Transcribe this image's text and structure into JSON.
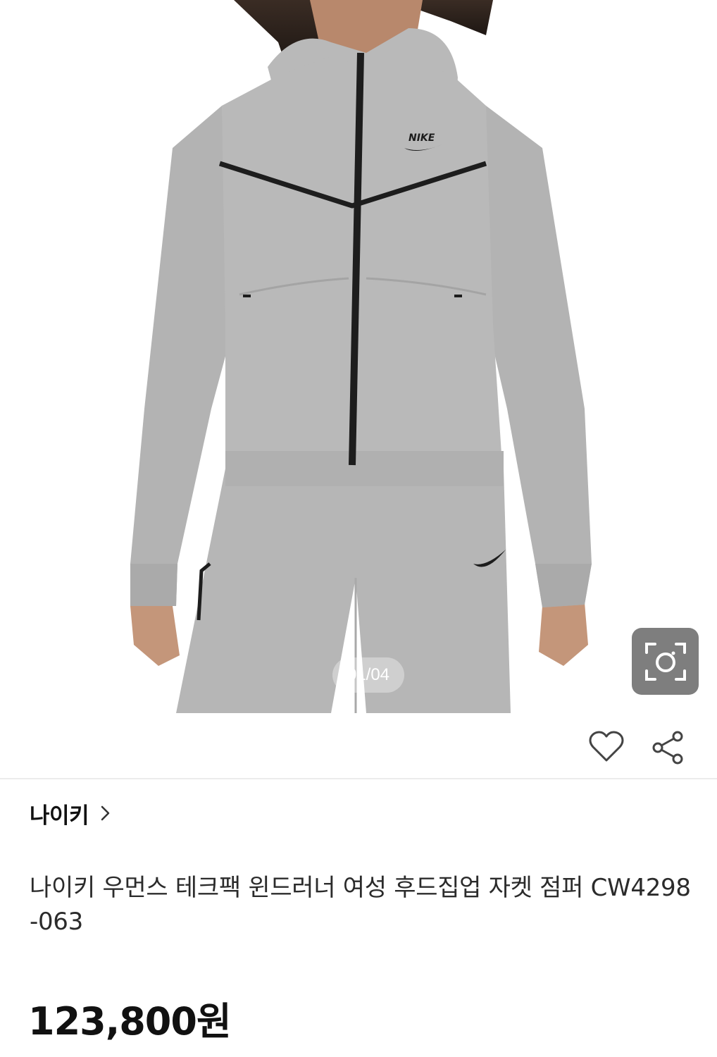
{
  "gallery": {
    "counter": "01/04",
    "garment_logo": "NIKE"
  },
  "icons": {
    "lens": "image-search-icon",
    "like": "heart-outline-icon",
    "share": "share-icon",
    "brand_arrow": "chevron-right-icon"
  },
  "colors": {
    "garment": "#b7b7b7",
    "trim": "#1d1d1d",
    "lens_button": "#7e7e7e"
  },
  "brand": {
    "name": "나이키"
  },
  "product": {
    "title": "나이키 우먼스 테크팩 윈드러너 여성 후드집업 자켓 점퍼 CW4298-063",
    "price": "123,800원"
  }
}
